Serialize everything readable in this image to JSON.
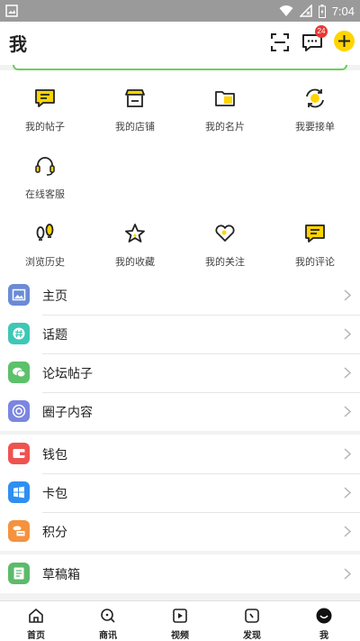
{
  "status_bar": {
    "time": "7:04"
  },
  "header": {
    "title": "我",
    "message_badge": "24"
  },
  "grid": {
    "items": [
      {
        "label": "我的帖子",
        "icon": "post-icon"
      },
      {
        "label": "我的店铺",
        "icon": "shop-icon"
      },
      {
        "label": "我的名片",
        "icon": "folder-icon"
      },
      {
        "label": "我要接单",
        "icon": "sync-icon"
      },
      {
        "label": "在线客服",
        "icon": "headset-icon"
      },
      {
        "label": "浏览历史",
        "icon": "footprint-icon"
      },
      {
        "label": "我的收藏",
        "icon": "star-icon"
      },
      {
        "label": "我的关注",
        "icon": "heart-icon"
      },
      {
        "label": "我的评论",
        "icon": "comment-icon"
      }
    ]
  },
  "menu": {
    "group1": [
      {
        "label": "主页",
        "icon": "image-icon",
        "color": "#6b8bd6"
      },
      {
        "label": "话题",
        "icon": "hashtag-icon",
        "color": "#3ec7b6"
      },
      {
        "label": "论坛帖子",
        "icon": "chat-icon",
        "color": "#5cc16a"
      },
      {
        "label": "圈子内容",
        "icon": "circle-icon",
        "color": "#7b86e0"
      }
    ],
    "group2": [
      {
        "label": "钱包",
        "icon": "wallet-icon",
        "color": "#ef5350"
      },
      {
        "label": "卡包",
        "icon": "card-icon",
        "color": "#2f8ff0"
      },
      {
        "label": "积分",
        "icon": "coins-icon",
        "color": "#f5923e"
      }
    ],
    "group3": [
      {
        "label": "草稿箱",
        "icon": "draft-icon",
        "color": "#5cbb6a"
      }
    ]
  },
  "bottom_nav": [
    {
      "label": "首页",
      "icon": "home-icon"
    },
    {
      "label": "商讯",
      "icon": "search-icon"
    },
    {
      "label": "视频",
      "icon": "video-icon"
    },
    {
      "label": "发现",
      "icon": "compass-icon"
    },
    {
      "label": "我",
      "icon": "me-icon"
    }
  ]
}
